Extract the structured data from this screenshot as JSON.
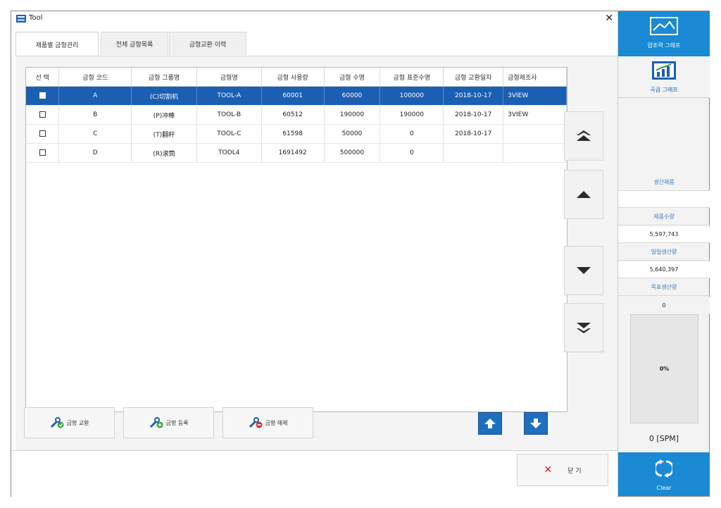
{
  "window": {
    "title": "Tool"
  },
  "tabs": [
    {
      "label": "제품별 금형관리",
      "active": true
    },
    {
      "label": "전체 금형목록",
      "active": false
    },
    {
      "label": "금형교환 이력",
      "active": false
    }
  ],
  "table": {
    "headers": [
      "선 택",
      "금형 코드",
      "금형 그룹명",
      "금형명",
      "금형 사용량",
      "금형 수명",
      "금형 표준수명",
      "금형 교환일자",
      "금형제조사"
    ],
    "rows": [
      {
        "selected": true,
        "cells": [
          "A",
          "(C)切割机",
          "TOOL-A",
          "60001",
          "60000",
          "100000",
          "2018-10-17",
          "3VIEW"
        ]
      },
      {
        "selected": false,
        "cells": [
          "B",
          "(P)冲棒",
          "TOOL-B",
          "60512",
          "190000",
          "190000",
          "2018-10-17",
          "3VIEW"
        ]
      },
      {
        "selected": false,
        "cells": [
          "C",
          "(T)翻杆",
          "TOOL-C",
          "61598",
          "50000",
          "0",
          "2018-10-17",
          ""
        ]
      },
      {
        "selected": false,
        "cells": [
          "D",
          "(R)滚筒",
          "TOOL4",
          "1691492",
          "500000",
          "0",
          "",
          ""
        ]
      }
    ]
  },
  "actions": {
    "replace": "금형 교환",
    "register": "금형 등록",
    "remove": "금형 해제"
  },
  "footer": {
    "close_label": "닫 기"
  },
  "side": {
    "pressure_graph": "압조력 그래프",
    "trend_graph": "곡곱 그래프",
    "product_header": "생산제품",
    "product_value": "",
    "qty_header": "제품수량",
    "qty_value": "5,597,743",
    "daily_header": "일일생산량",
    "daily_value": "5,640,397",
    "target_header": "목표생산량",
    "target_value": "0",
    "gauge_value": "0%",
    "spm": "0 [SPM]",
    "clear": "Clear"
  },
  "icons": {
    "app": "tool-app-icon",
    "close": "close-icon",
    "nav": [
      "double-chevron-up-icon",
      "chevron-up-icon",
      "chevron-down-icon",
      "double-chevron-down-icon"
    ]
  },
  "colors": {
    "accent": "#1a8ad4",
    "selection": "#1b5fb2",
    "button_blue": "#1f6fbf",
    "close_x": "#d01818"
  }
}
